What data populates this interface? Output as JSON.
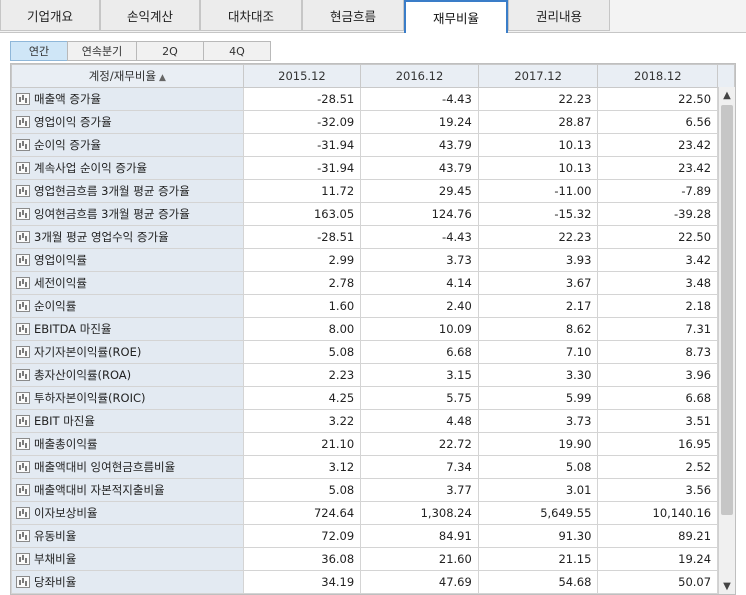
{
  "tabs": [
    "기업개요",
    "손익계산",
    "대차대조",
    "현금흐름",
    "재무비율",
    "권리내용"
  ],
  "active_tab": 4,
  "subtabs": [
    "연간",
    "연속분기",
    "2Q",
    "4Q"
  ],
  "active_subtab": 0,
  "table": {
    "header_label": "계정/재무비율",
    "sort_icon": "▲",
    "columns": [
      "2015.12",
      "2016.12",
      "2017.12",
      "2018.12"
    ],
    "rows": [
      {
        "label": "매출액 증가율",
        "values": [
          "-28.51",
          "-4.43",
          "22.23",
          "22.50"
        ]
      },
      {
        "label": "영업이익 증가율",
        "values": [
          "-32.09",
          "19.24",
          "28.87",
          "6.56"
        ]
      },
      {
        "label": "순이익 증가율",
        "values": [
          "-31.94",
          "43.79",
          "10.13",
          "23.42"
        ]
      },
      {
        "label": "계속사업 순이익 증가율",
        "values": [
          "-31.94",
          "43.79",
          "10.13",
          "23.42"
        ]
      },
      {
        "label": "영업현금흐름 3개월 평균 증가율",
        "values": [
          "11.72",
          "29.45",
          "-11.00",
          "-7.89"
        ]
      },
      {
        "label": "잉여현금흐름 3개월 평균 증가율",
        "values": [
          "163.05",
          "124.76",
          "-15.32",
          "-39.28"
        ]
      },
      {
        "label": "3개월 평균 영업수익 증가율",
        "values": [
          "-28.51",
          "-4.43",
          "22.23",
          "22.50"
        ]
      },
      {
        "label": "영업이익률",
        "values": [
          "2.99",
          "3.73",
          "3.93",
          "3.42"
        ]
      },
      {
        "label": "세전이익률",
        "values": [
          "2.78",
          "4.14",
          "3.67",
          "3.48"
        ]
      },
      {
        "label": "순이익률",
        "values": [
          "1.60",
          "2.40",
          "2.17",
          "2.18"
        ]
      },
      {
        "label": "EBITDA 마진율",
        "values": [
          "8.00",
          "10.09",
          "8.62",
          "7.31"
        ]
      },
      {
        "label": "자기자본이익률(ROE)",
        "values": [
          "5.08",
          "6.68",
          "7.10",
          "8.73"
        ]
      },
      {
        "label": "총자산이익률(ROA)",
        "values": [
          "2.23",
          "3.15",
          "3.30",
          "3.96"
        ]
      },
      {
        "label": "투하자본이익률(ROIC)",
        "values": [
          "4.25",
          "5.75",
          "5.99",
          "6.68"
        ]
      },
      {
        "label": "EBIT 마진율",
        "values": [
          "3.22",
          "4.48",
          "3.73",
          "3.51"
        ]
      },
      {
        "label": "매출총이익률",
        "values": [
          "21.10",
          "22.72",
          "19.90",
          "16.95"
        ]
      },
      {
        "label": "매출액대비 잉여현금흐름비율",
        "values": [
          "3.12",
          "7.34",
          "5.08",
          "2.52"
        ]
      },
      {
        "label": "매출액대비 자본적지출비율",
        "values": [
          "5.08",
          "3.77",
          "3.01",
          "3.56"
        ]
      },
      {
        "label": "이자보상비율",
        "values": [
          "724.64",
          "1,308.24",
          "5,649.55",
          "10,140.16"
        ]
      },
      {
        "label": "유동비율",
        "values": [
          "72.09",
          "84.91",
          "91.30",
          "89.21"
        ]
      },
      {
        "label": "부채비율",
        "values": [
          "36.08",
          "21.60",
          "21.15",
          "19.24"
        ]
      },
      {
        "label": "당좌비율",
        "values": [
          "34.19",
          "47.69",
          "54.68",
          "50.07"
        ]
      }
    ]
  },
  "icons": {
    "row_chart": "chart-icon",
    "scroll_up": "▲",
    "scroll_down": "▼"
  }
}
